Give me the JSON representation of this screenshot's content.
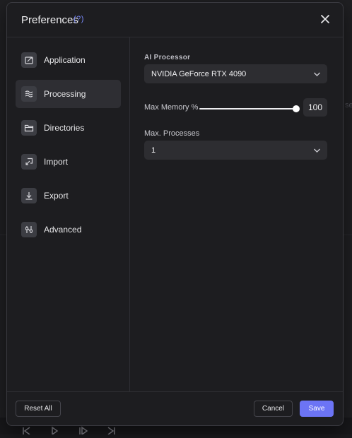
{
  "dialog": {
    "title": "Preferences",
    "help_label": "(?)"
  },
  "sidebar": {
    "items": [
      {
        "label": "Application",
        "icon": "application-icon",
        "active": false
      },
      {
        "label": "Processing",
        "icon": "processing-icon",
        "active": true
      },
      {
        "label": "Directories",
        "icon": "folder-icon",
        "active": false
      },
      {
        "label": "Import",
        "icon": "import-icon",
        "active": false
      },
      {
        "label": "Export",
        "icon": "export-icon",
        "active": false
      },
      {
        "label": "Advanced",
        "icon": "advanced-icon",
        "active": false
      }
    ]
  },
  "processing": {
    "ai_processor_label": "AI Processor",
    "ai_processor_value": "NVIDIA GeForce RTX 4090",
    "max_memory_label": "Max Memory %",
    "max_memory_value": "100",
    "max_memory_fraction": 1.0,
    "max_processes_label": "Max. Processes",
    "max_processes_value": "1"
  },
  "footer": {
    "reset_label": "Reset All",
    "cancel_label": "Cancel",
    "save_label": "Save"
  },
  "background": {
    "fragment_text": "set"
  },
  "colors": {
    "accent": "#6c74f5",
    "help": "#7b8cff",
    "modal_bg": "#1d1d20",
    "active_item_bg": "#2e2e33"
  }
}
